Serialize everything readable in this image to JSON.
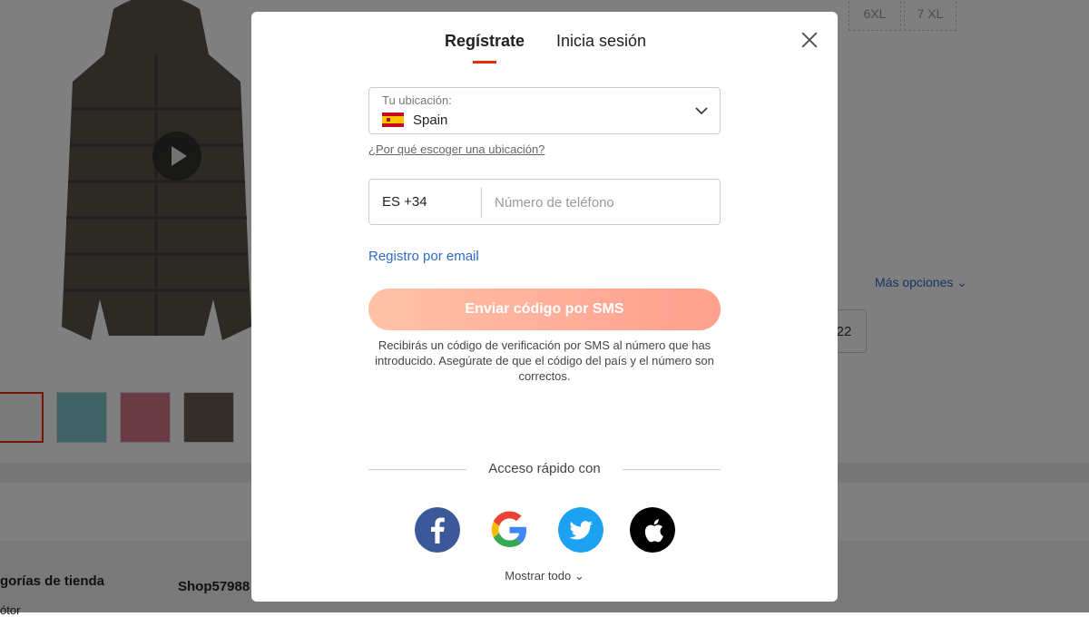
{
  "background": {
    "size_options": [
      "6XL",
      "7 XL"
    ],
    "more_options_label": "Más opciones",
    "selected_value_partial": "22",
    "store_categories_label": "gorías de tienda",
    "store_name": "Shop57988",
    "store_sub_label": "ótor"
  },
  "modal": {
    "tabs": [
      {
        "label": "Regístrate",
        "active": true
      },
      {
        "label": "Inicia sesión",
        "active": false
      }
    ],
    "location": {
      "label": "Tu ubicación:",
      "value": "Spain",
      "why_link": "¿Por qué escoger una ubicación?"
    },
    "phone": {
      "country_code": "ES +34",
      "placeholder": "Número de teléfono"
    },
    "email_link": "Registro por email",
    "sms_button": "Enviar código por SMS",
    "sms_note": "Recibirás un código de verificación por SMS al número que has introducido. Asegúrate de que el código del país y el número son correctos.",
    "quick_access_label": "Acceso rápido con",
    "social_icons": [
      "facebook-icon",
      "google-icon",
      "twitter-icon",
      "apple-icon"
    ],
    "show_all_label": "Mostrar todo"
  },
  "colors": {
    "accent": "#e62e04",
    "link": "#2e6bc6",
    "facebook": "#3b5998",
    "twitter": "#1da1f2",
    "apple": "#000000"
  }
}
